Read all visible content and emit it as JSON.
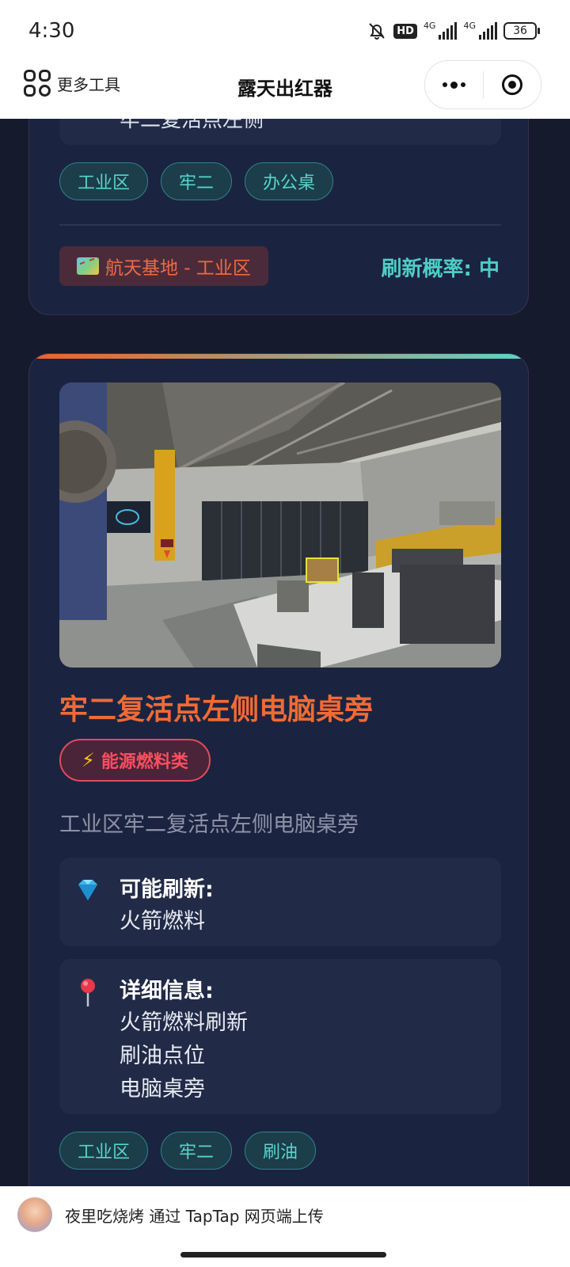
{
  "status_bar": {
    "time": "4:30",
    "hd": "HD",
    "network1": "4G",
    "network2": "4G",
    "battery": "36"
  },
  "nav": {
    "more_tools": "更多工具",
    "title": "露天出红器"
  },
  "card1": {
    "partial_text": "牢二复活点左侧",
    "tags": [
      "工业区",
      "牢二",
      "办公桌"
    ],
    "map_chip": "航天基地 - 工业区",
    "refresh_rate": "刷新概率: 中"
  },
  "card2": {
    "title": "牢二复活点左侧电脑桌旁",
    "category": "能源燃料类",
    "description": "工业区牢二复活点左侧电脑桌旁",
    "possible_refresh": {
      "heading": "可能刷新:",
      "lines": [
        "火箭燃料"
      ]
    },
    "details": {
      "heading": "详细信息:",
      "lines": [
        "火箭燃料刷新",
        "刷油点位",
        "电脑桌旁"
      ]
    },
    "tags": [
      "工业区",
      "牢二",
      "刷油"
    ]
  },
  "uploader": {
    "text": "夜里吃烧烤 通过 TapTap 网页端上传"
  },
  "icons": {
    "more_tools": "grid-icon",
    "menu": "more-dots-icon",
    "close": "target-icon",
    "map": "map-icon",
    "bolt": "lightning-icon",
    "gem": "gem-icon",
    "pin": "pin-icon",
    "mute": "bell-off-icon"
  },
  "colors": {
    "accent_orange": "#f06a35",
    "accent_teal": "#4ecdc4",
    "category_red": "#ff4d5e",
    "background": "#151a2c"
  }
}
